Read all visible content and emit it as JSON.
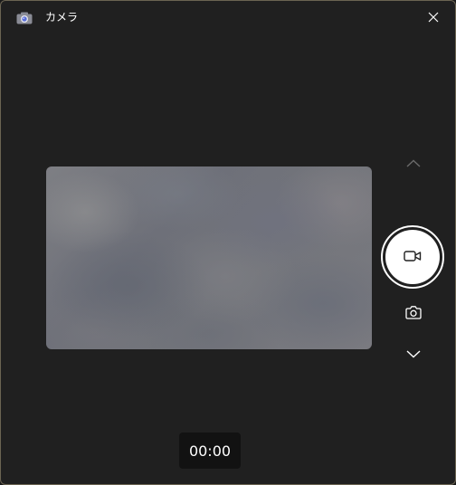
{
  "window": {
    "title": "カメラ",
    "app_icon": "camera-app-icon",
    "close_icon": "close-icon"
  },
  "controls": {
    "mode_up_icon": "chevron-up-icon",
    "record_icon": "video-camera-icon",
    "photo_icon": "camera-icon",
    "mode_down_icon": "chevron-down-icon"
  },
  "status": {
    "timer": "00:00"
  },
  "colors": {
    "background": "#202020",
    "accent": "#ffffff",
    "border": "#6b6452"
  }
}
